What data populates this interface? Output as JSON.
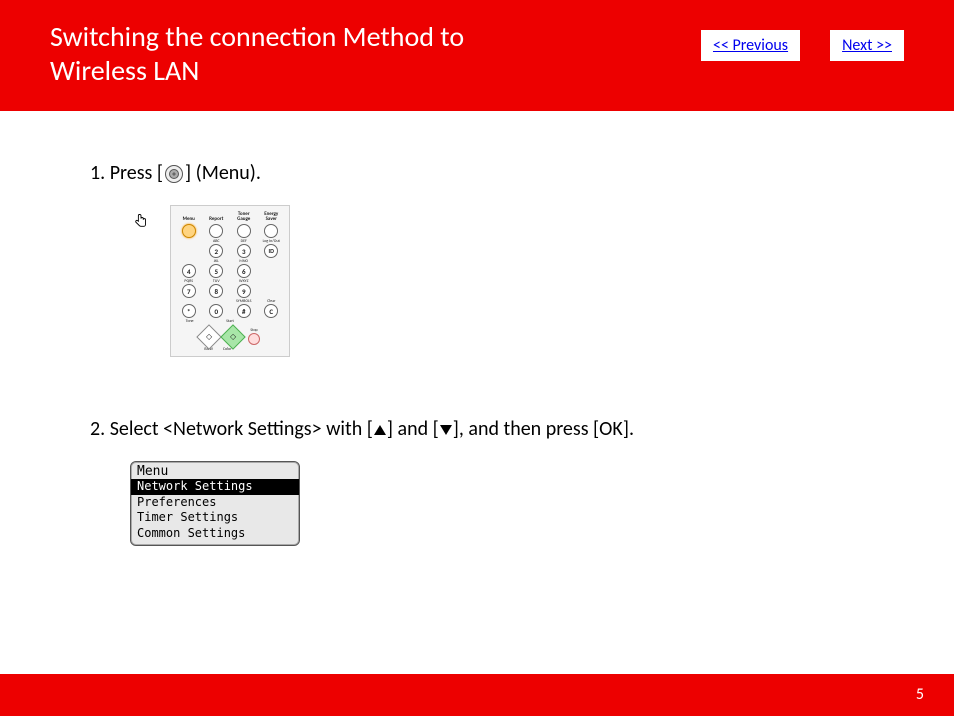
{
  "header": {
    "title": "Switching the connection Method to Wireless LAN",
    "prev": "<< Previous",
    "next": "Next >>"
  },
  "steps": {
    "s1_a": "1. Press [",
    "s1_b": "] (Menu).",
    "s2_a": "2. Select <Network Settings> with [",
    "s2_b": "] and [",
    "s2_c": "], and then press [OK]."
  },
  "panel": {
    "top": {
      "c1": "Menu",
      "c2": "Report",
      "c3": "Toner Gauge",
      "c4": "Energy Saver"
    },
    "r2sub": {
      "c2": "ABC",
      "c3": "DEF",
      "c4": "Log In/Out"
    },
    "r2": {
      "c2": "2",
      "c3": "3",
      "c4": "ID"
    },
    "r3sub": {
      "c1": "",
      "c2": "JKL",
      "c3": "MNO"
    },
    "r3": {
      "c1": "4",
      "c2": "5",
      "c3": "6"
    },
    "r4sub": {
      "c1": "PQRS",
      "c2": "TUV",
      "c3": "WXYZ"
    },
    "r4": {
      "c1": "7",
      "c2": "8",
      "c3": "9"
    },
    "r5sub": {
      "c1": "",
      "c2": "",
      "c3": "SYMBOLS",
      "c4": "Clear"
    },
    "r5": {
      "c1": "*",
      "c2": "0",
      "c3": "#",
      "c4": "C"
    },
    "tone": "Tone",
    "start": "Start",
    "stop": "Stop",
    "bw": "B&W",
    "color": "Color"
  },
  "lcd": {
    "title": "Menu",
    "i1": "Network Settings",
    "i2": "Preferences",
    "i3": "Timer Settings",
    "i4": "Common Settings"
  },
  "page": "5"
}
